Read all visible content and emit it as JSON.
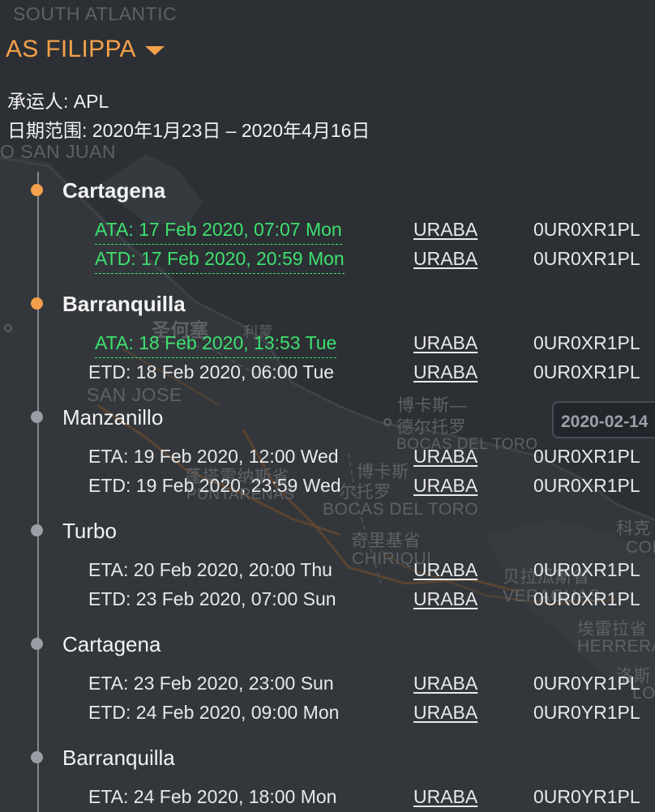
{
  "map": {
    "labels": {
      "south_atlantic": "SOUTH ATLANTIC",
      "san_juan": "O SAN JUAN",
      "san_jose_zh": "圣何塞",
      "san_jose": "SAN JOSE",
      "bocas_zh": "博卡斯—",
      "bocas_zh2": "德尔托罗",
      "bocas_upper": "BOCAS DEL TORO",
      "bocas_lower": "BOCAS DEL TORO",
      "bocas_zh3": "博卡斯",
      "bocas_zh4": "尔托罗",
      "puntarenas_zh": "蓬塔雷纳斯省",
      "puntarenas": "PUNTARENAS",
      "chiriqui_zh": "奇里基省",
      "chiriqui": "CHIRIQUI",
      "colon_zh": "科克",
      "colon": "COL",
      "veraguas_zh": "贝拉瓜斯省",
      "veraguas": "VERAGUAS",
      "herrera_zh": "埃雷拉省",
      "herrera": "HERRERA",
      "los_santos_zh": "洛斯",
      "los_santos": "LOS S",
      "ruta": "利蒙"
    },
    "date_chip": "2020-02-14"
  },
  "vessel": {
    "name": "AS FILIPPA",
    "carrier": "承运人: APL",
    "date_range": "日期范围: 2020年1月23日 – 2020年4月16日"
  },
  "stops": [
    {
      "port": "Cartagena",
      "status": "active",
      "events": [
        {
          "text": "ATA: 17 Feb 2020, 07:07 Mon",
          "actual": true,
          "vessel": "URABA",
          "voyage": "0UR0XR1PL"
        },
        {
          "text": "ATD: 17 Feb 2020, 20:59 Mon",
          "actual": true,
          "vessel": "URABA",
          "voyage": "0UR0XR1PL"
        }
      ]
    },
    {
      "port": "Barranquilla",
      "status": "active",
      "events": [
        {
          "text": "ATA: 18 Feb 2020, 13:53 Tue",
          "actual": true,
          "vessel": "URABA",
          "voyage": "0UR0XR1PL"
        },
        {
          "text": "ETD: 18 Feb 2020, 06:00 Tue",
          "actual": false,
          "vessel": "URABA",
          "voyage": "0UR0XR1PL"
        }
      ]
    },
    {
      "port": "Manzanillo",
      "status": "pending",
      "events": [
        {
          "text": "ETA: 19 Feb 2020, 12:00 Wed",
          "actual": false,
          "vessel": "URABA",
          "voyage": "0UR0XR1PL"
        },
        {
          "text": "ETD: 19 Feb 2020, 23:59 Wed",
          "actual": false,
          "vessel": "URABA",
          "voyage": "0UR0XR1PL"
        }
      ]
    },
    {
      "port": "Turbo",
      "status": "pending",
      "events": [
        {
          "text": "ETA: 20 Feb 2020, 20:00 Thu",
          "actual": false,
          "vessel": "URABA",
          "voyage": "0UR0XR1PL"
        },
        {
          "text": "ETD: 23 Feb 2020, 07:00 Sun",
          "actual": false,
          "vessel": "URABA",
          "voyage": "0UR0XR1PL"
        }
      ]
    },
    {
      "port": "Cartagena",
      "status": "pending",
      "events": [
        {
          "text": "ETA: 23 Feb 2020, 23:00 Sun",
          "actual": false,
          "vessel": "URABA",
          "voyage": "0UR0YR1PL"
        },
        {
          "text": "ETD: 24 Feb 2020, 09:00 Mon",
          "actual": false,
          "vessel": "URABA",
          "voyage": "0UR0YR1PL"
        }
      ]
    },
    {
      "port": "Barranquilla",
      "status": "pending",
      "events": [
        {
          "text": "ETA: 24 Feb 2020, 18:00 Mon",
          "actual": false,
          "vessel": "URABA",
          "voyage": "0UR0YR1PL"
        }
      ]
    }
  ],
  "colors": {
    "accent": "#f5a04a",
    "actual_time": "#3ee06e",
    "background": "#2c3035"
  }
}
